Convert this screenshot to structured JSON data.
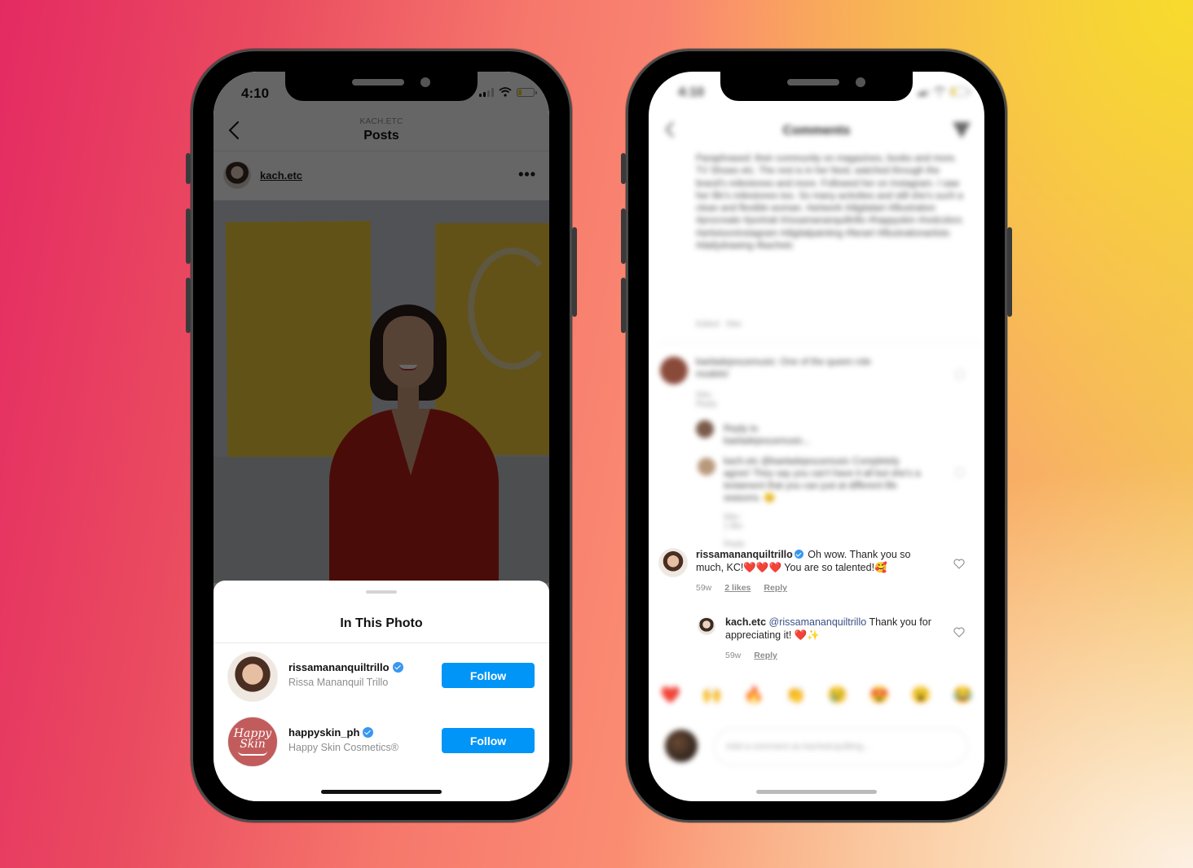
{
  "left_phone": {
    "status": {
      "time": "4:10"
    },
    "header": {
      "subtitle": "KACH.ETC",
      "title": "Posts"
    },
    "post": {
      "username": "kach.etc",
      "more_icon": "more-horizontal-icon"
    },
    "sheet": {
      "title": "In This Photo",
      "tags": [
        {
          "username": "rissamananquiltrillo",
          "full_name": "Rissa Mananquil Trillo",
          "verified": true,
          "button": "Follow"
        },
        {
          "username": "happyskin_ph",
          "full_name": "Happy Skin Cosmetics®",
          "verified": true,
          "button": "Follow",
          "avatar_text": [
            "Happy",
            "Skin"
          ]
        }
      ]
    }
  },
  "right_phone": {
    "status": {
      "time": "4:10"
    },
    "header": {
      "title": "Comments"
    },
    "blurred_caption": "Paraphrased: their community on magazines, books and more. TV Shows etc. The rest is in her feed, watched through the brand's milestones and more. Followed her on Instagram. I saw her life's milestones too. So many activities and still she's such a clean and flexible woman. #artwork #digitalart #illustration #procreate #portrait #rissamananquiltrillo #happyskin #redcolors #artistsoninstagram #digitalpainting #fanart #illustrationartists #dailydrawing #kachetc",
    "blurred_caption_meta": "Edited · 59w",
    "blurred_comments": [
      {
        "text": "kaeladejesusmusic: One of the queen role models!",
        "meta": "59w · Reply"
      },
      {
        "text": "Reply to kaeladejesusmusic..."
      },
      {
        "text": "kach.etc @kaeladejesusmusic Completely agree! They say you can't have it all but she's a testament that you can just at different life seasons. 😊",
        "meta": "59w · 1 like · Reply"
      }
    ],
    "comments": [
      {
        "username": "rissamananquiltrillo",
        "verified": true,
        "text_before": "Oh wow. Thank you so much, KC!",
        "hearts": "❤️❤️❤️",
        "text_after": " You are so talented!🥰",
        "time": "59w",
        "likes": "2 likes",
        "reply": "Reply"
      },
      {
        "username": "kach.etc",
        "mention": "@rissamananquiltrillo",
        "text": " Thank you for appreciating it! ❤️✨",
        "time": "59w",
        "reply": "Reply"
      }
    ],
    "emoji_bar": [
      "❤️",
      "🙌",
      "🔥",
      "👏",
      "😢",
      "😍",
      "😮",
      "😂"
    ],
    "comment_input": {
      "placeholder": "Add a comment as kachetcquilting..."
    }
  },
  "colors": {
    "follow_button": "#0095f6",
    "verified_badge": "#3897f0",
    "mention": "#385185",
    "bg_pink": "#e42a62",
    "bg_yellow": "#f7db2c",
    "bg_cream": "#fdf0e4"
  }
}
